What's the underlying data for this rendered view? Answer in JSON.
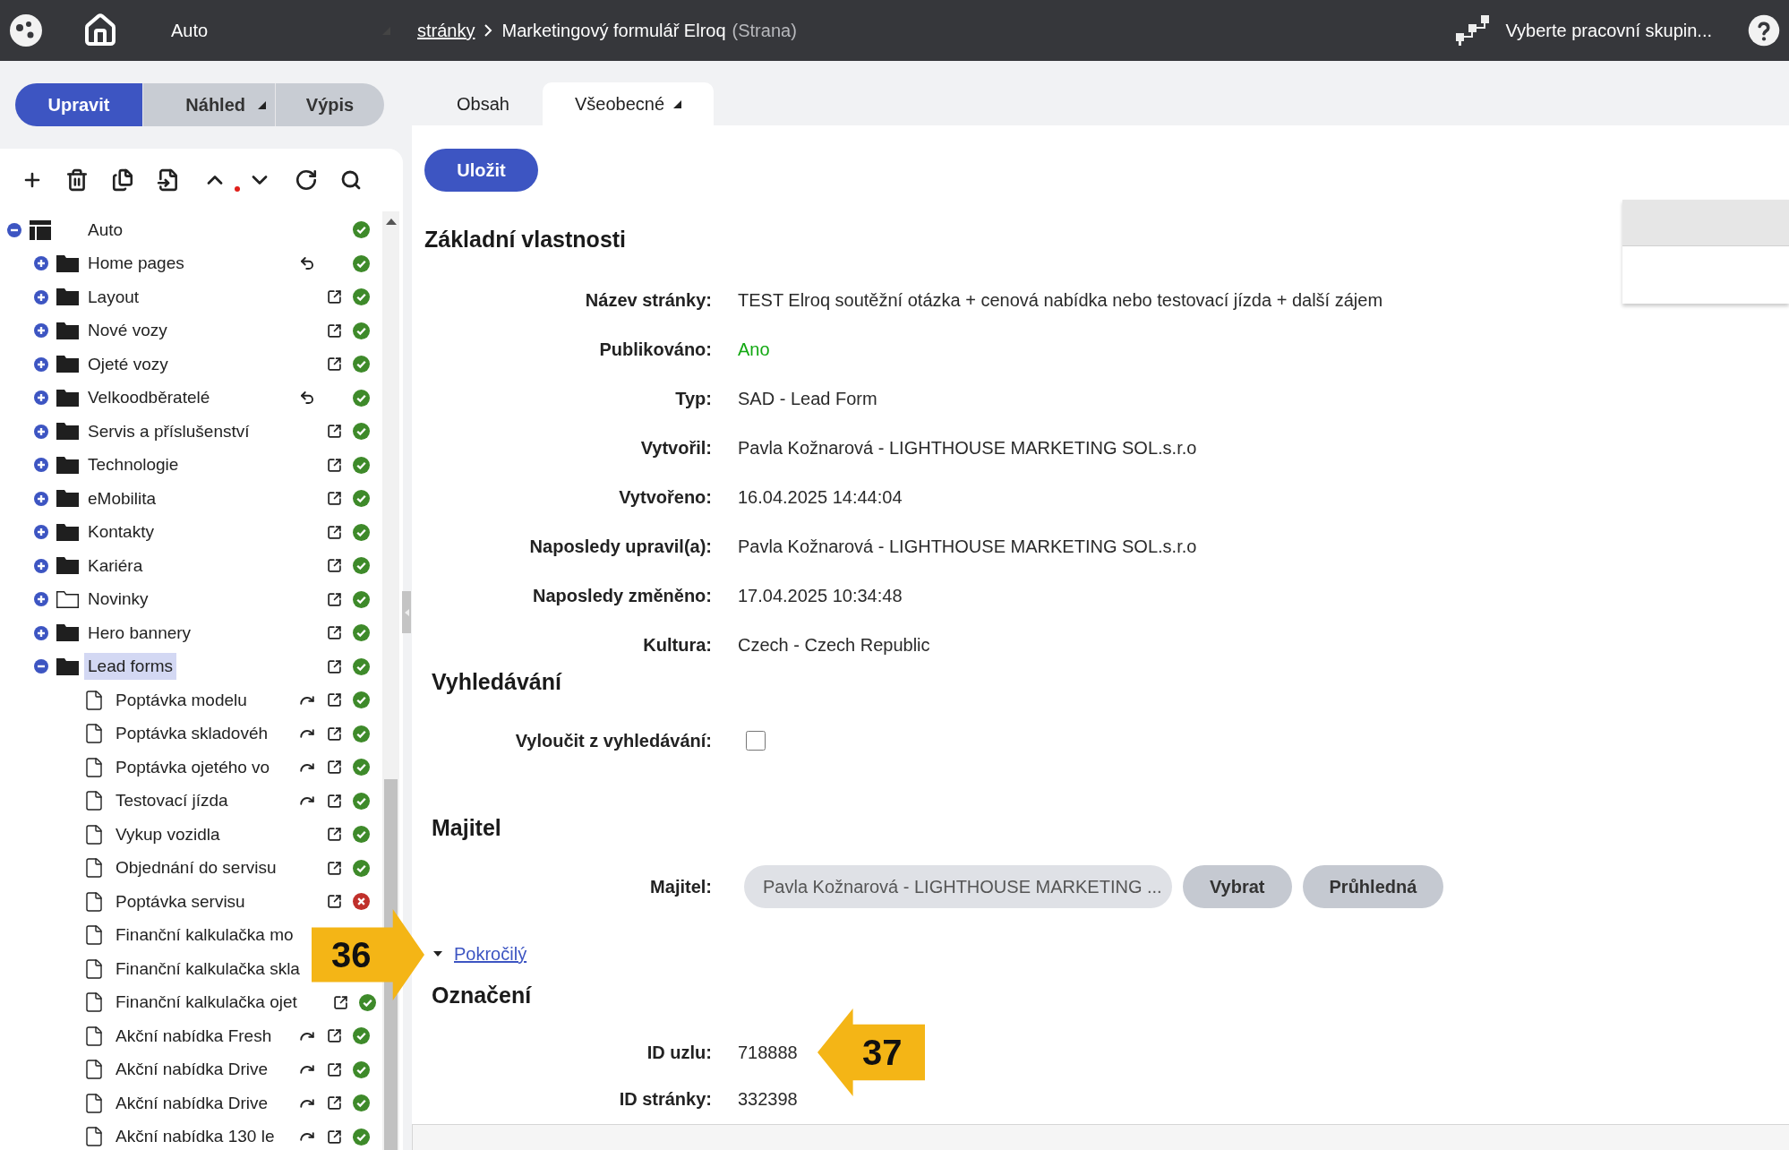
{
  "top_bar": {
    "site": "Auto",
    "breadcrumb": [
      {
        "label": "stránky",
        "kind": "link"
      },
      {
        "label": "Marketingový formulář Elroq",
        "kind": "current"
      }
    ],
    "page_type": "(Strana)",
    "workgroup": "Vyberte pracovní skupin..."
  },
  "modes": [
    {
      "label": "Upravit",
      "selected": true,
      "dropdown": false
    },
    {
      "label": "Náhled",
      "selected": false,
      "dropdown": true
    },
    {
      "label": "Výpis",
      "selected": false,
      "dropdown": false
    }
  ],
  "tabs": [
    {
      "label": "Obsah",
      "selected": false,
      "dropdown": false
    },
    {
      "label": "Všeobecné",
      "selected": true,
      "dropdown": true
    }
  ],
  "tree": {
    "label": "Auto",
    "kind": "root",
    "expanded": true,
    "selected": false,
    "published": true,
    "children": [
      {
        "label": "Home pages",
        "kind": "folder",
        "expanded": false,
        "selected": false,
        "undo": true,
        "redo": false,
        "external": false,
        "published": true
      },
      {
        "label": "Layout",
        "kind": "folder",
        "expanded": false,
        "selected": false,
        "undo": false,
        "redo": false,
        "external": true,
        "published": true
      },
      {
        "label": "Nové vozy",
        "kind": "folder",
        "expanded": false,
        "selected": false,
        "undo": false,
        "redo": false,
        "external": true,
        "published": true
      },
      {
        "label": "Ojeté vozy",
        "kind": "folder",
        "expanded": false,
        "selected": false,
        "undo": false,
        "redo": false,
        "external": true,
        "published": true
      },
      {
        "label": "Velkoodběratelé",
        "kind": "folder",
        "expanded": false,
        "selected": false,
        "undo": true,
        "redo": false,
        "external": false,
        "published": true
      },
      {
        "label": "Servis a příslušenství",
        "kind": "folder",
        "expanded": false,
        "selected": false,
        "undo": false,
        "redo": false,
        "external": true,
        "published": true
      },
      {
        "label": "Technologie",
        "kind": "folder",
        "expanded": false,
        "selected": false,
        "undo": false,
        "redo": false,
        "external": true,
        "published": true
      },
      {
        "label": "eMobilita",
        "kind": "folder",
        "expanded": false,
        "selected": false,
        "undo": false,
        "redo": false,
        "external": true,
        "published": true
      },
      {
        "label": "Kontakty",
        "kind": "folder",
        "expanded": false,
        "selected": false,
        "undo": false,
        "redo": false,
        "external": true,
        "published": true
      },
      {
        "label": "Kariéra",
        "kind": "folder",
        "expanded": false,
        "selected": false,
        "undo": false,
        "redo": false,
        "external": true,
        "published": true
      },
      {
        "label": "Novinky",
        "kind": "folder-empty",
        "expanded": false,
        "selected": false,
        "undo": false,
        "redo": false,
        "external": true,
        "published": true
      },
      {
        "label": "Hero bannery",
        "kind": "folder",
        "expanded": false,
        "selected": false,
        "undo": false,
        "redo": false,
        "external": true,
        "published": true
      },
      {
        "label": "Lead forms",
        "kind": "folder",
        "expanded": true,
        "selected": true,
        "undo": false,
        "redo": false,
        "external": true,
        "published": true,
        "children": [
          {
            "label": "Poptávka modelu",
            "kind": "page",
            "selected": false,
            "undo": false,
            "redo": true,
            "external": true,
            "published": true
          },
          {
            "label": "Poptávka skladovéh",
            "kind": "page",
            "selected": false,
            "undo": false,
            "redo": true,
            "external": true,
            "published": true
          },
          {
            "label": "Poptávka ojetého vo",
            "kind": "page",
            "selected": false,
            "undo": false,
            "redo": true,
            "external": true,
            "published": true
          },
          {
            "label": "Testovací jízda",
            "kind": "page",
            "selected": false,
            "undo": false,
            "redo": true,
            "external": true,
            "published": true
          },
          {
            "label": "Vykup vozidla",
            "kind": "page",
            "selected": false,
            "undo": false,
            "redo": false,
            "external": true,
            "published": true
          },
          {
            "label": "Objednání do servisu",
            "kind": "page",
            "selected": false,
            "undo": false,
            "redo": false,
            "external": true,
            "published": true
          },
          {
            "label": "Poptávka servisu",
            "kind": "page",
            "selected": false,
            "undo": false,
            "redo": false,
            "external": true,
            "published": false
          },
          {
            "label": "Finanční kalkulačka mo",
            "kind": "page",
            "selected": false
          },
          {
            "label": "Finanční kalkulačka skla",
            "kind": "page",
            "selected": false
          },
          {
            "label": "Finanční kalkulačka ojet",
            "kind": "page",
            "selected": false,
            "undo": false,
            "redo": false,
            "external": true,
            "published": true
          },
          {
            "label": "Akční nabídka Fresh",
            "kind": "page",
            "selected": false,
            "undo": false,
            "redo": true,
            "external": true,
            "published": true
          },
          {
            "label": "Akční nabídka Drive",
            "kind": "page",
            "selected": false,
            "undo": false,
            "redo": true,
            "external": true,
            "published": true
          },
          {
            "label": "Akční nabídka Drive",
            "kind": "page",
            "selected": false,
            "undo": false,
            "redo": true,
            "external": true,
            "published": true
          },
          {
            "label": "Akční nabídka 130 le",
            "kind": "page",
            "selected": false,
            "undo": false,
            "redo": true,
            "external": true,
            "published": true
          }
        ]
      }
    ]
  },
  "save_button": "Uložit",
  "sections": [
    {
      "kind": "group",
      "title": "Základní vlastnosti",
      "rows": [
        {
          "kind": "text",
          "label": "Název stránky:",
          "value": "TEST Elroq soutěžní otázka + cenová nabídka nebo testovací jízda + další zájem"
        },
        {
          "kind": "status",
          "label": "Publikováno:",
          "value": "Ano"
        },
        {
          "kind": "text",
          "label": "Typ:",
          "value": "SAD - Lead Form"
        },
        {
          "kind": "text",
          "label": "Vytvořil:",
          "value": "Pavla Kožnarová - LIGHTHOUSE MARKETING SOL.s.r.o"
        },
        {
          "kind": "text",
          "label": "Vytvořeno:",
          "value": "16.04.2025 14:44:04"
        },
        {
          "kind": "text",
          "label": "Naposledy upravil(a):",
          "value": "Pavla Kožnarová - LIGHTHOUSE MARKETING SOL.s.r.o"
        },
        {
          "kind": "text",
          "label": "Naposledy změněno:",
          "value": "17.04.2025 10:34:48"
        },
        {
          "kind": "text",
          "label": "Kultura:",
          "value": "Czech - Czech Republic"
        }
      ]
    },
    {
      "kind": "group",
      "title": "Vyhledávání",
      "rows": [
        {
          "kind": "checkbox",
          "label": "Vyloučit z vyhledávání:",
          "checked": false
        }
      ]
    },
    {
      "kind": "group",
      "title": "Majitel",
      "rows": [
        {
          "kind": "picker",
          "label": "Majitel:",
          "value": "Pavla Kožnarová - LIGHTHOUSE MARKETING ...",
          "buttons": [
            "Vybrat",
            "Průhledná"
          ]
        }
      ]
    },
    {
      "kind": "toggle",
      "label": "Pokročilý",
      "expanded": true
    },
    {
      "kind": "group",
      "title": "Označení",
      "rows": [
        {
          "kind": "text",
          "label": "ID uzlu:",
          "value": "718888"
        },
        {
          "kind": "text",
          "label": "ID stránky:",
          "value": "332398"
        }
      ]
    }
  ],
  "callouts": [
    {
      "number": "36"
    },
    {
      "number": "37"
    }
  ]
}
